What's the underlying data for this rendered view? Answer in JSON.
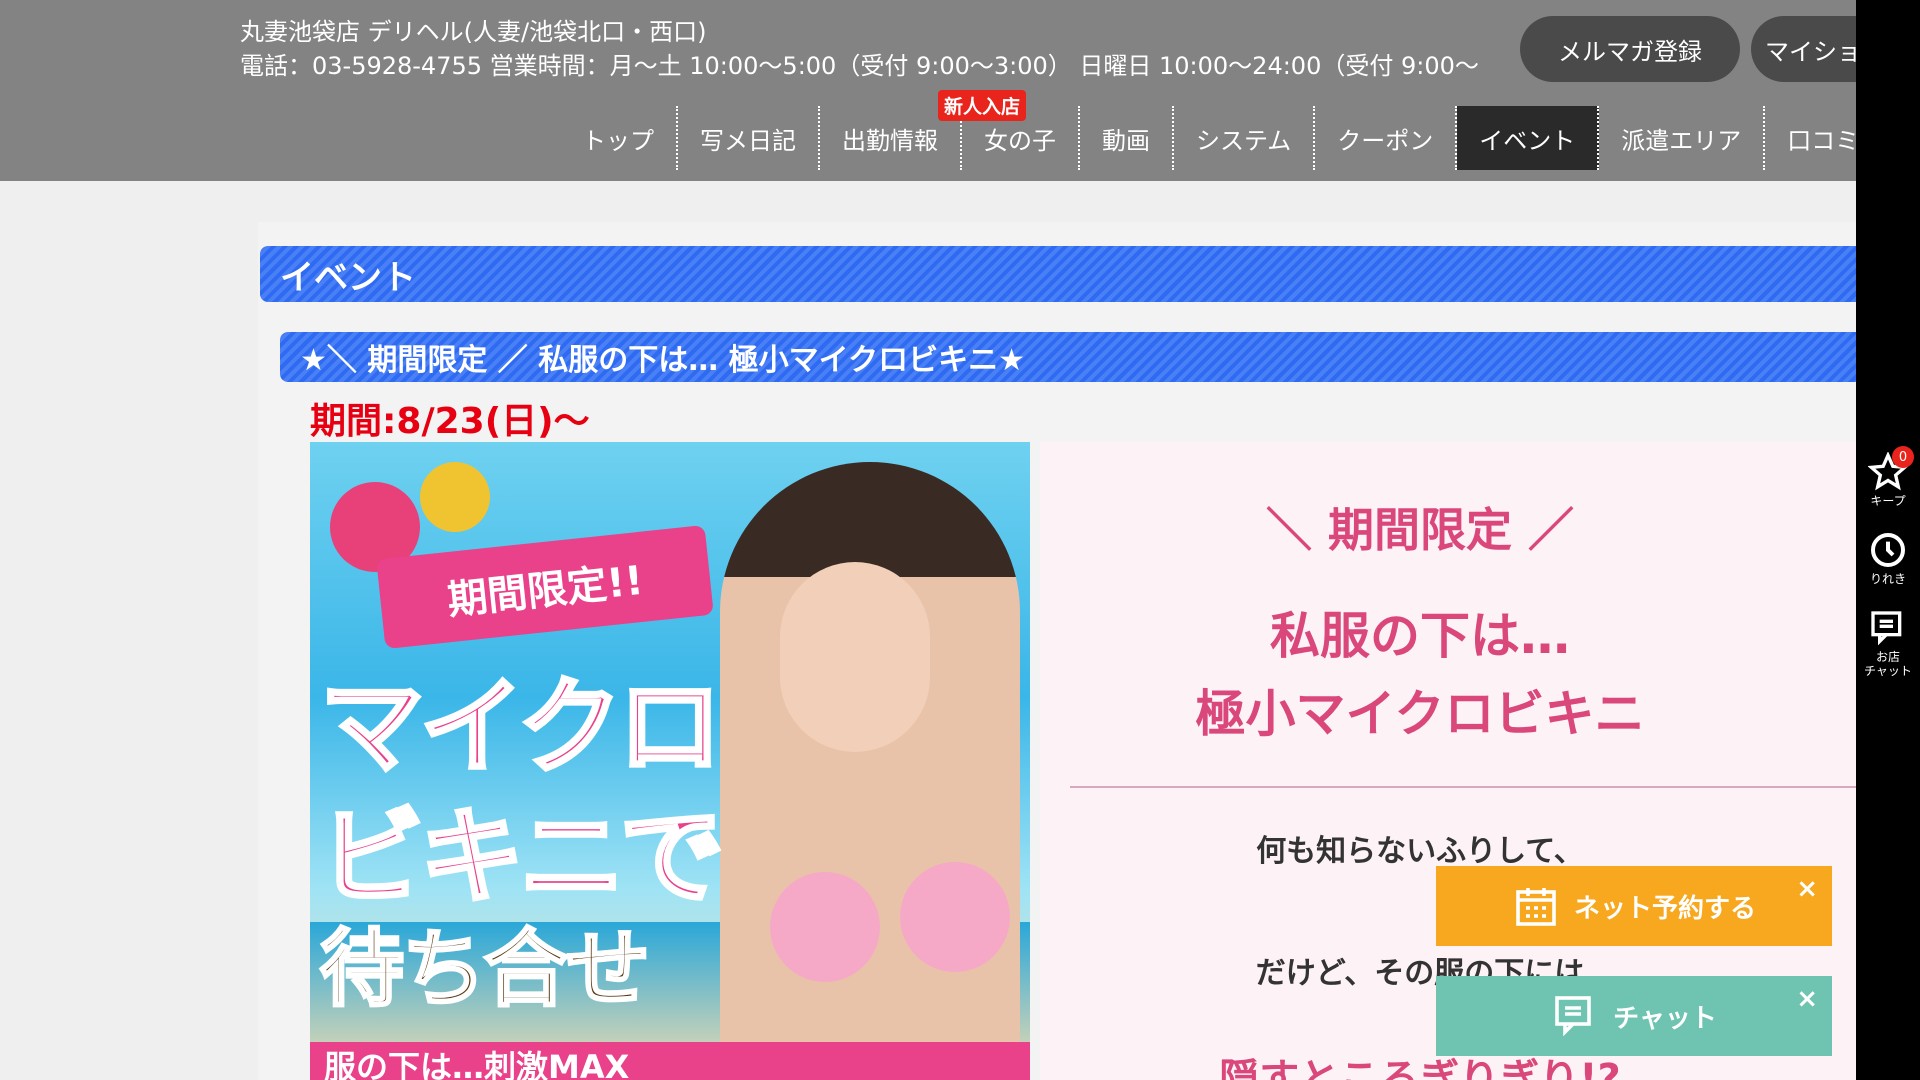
{
  "header": {
    "shop_name": "丸妻池袋店 デリヘル(人妻/池袋北口・西口)",
    "shop_info": "電話：03-5928-4755 営業時間：月〜土 10:00〜5:00（受付 9:00〜3:00） 日曜日 10:00〜24:00（受付 9:00〜",
    "mailmag_label": "メルマガ登録",
    "mypage_label": "マイショ",
    "new_badge": "新人入店"
  },
  "nav": {
    "items": [
      {
        "label": "トップ"
      },
      {
        "label": "写メ日記"
      },
      {
        "label": "出勤情報"
      },
      {
        "label": "女の子"
      },
      {
        "label": "動画"
      },
      {
        "label": "システム"
      },
      {
        "label": "クーポン"
      },
      {
        "label": "イベント"
      },
      {
        "label": "派遣エリア"
      },
      {
        "label": "口コミ"
      }
    ],
    "active": "イベント"
  },
  "sidebar": {
    "keep_label": "キープ",
    "keep_count": "0",
    "history_label": "りれき",
    "chat_label": "お店\nチャット"
  },
  "main": {
    "section_title": "イベント",
    "event_title": "★＼ 期間限定 ／ 私服の下は… 極小マイクロビキニ★",
    "period": "期間:8/23(日)〜",
    "banner": {
      "ribbon": "期間限定!!",
      "line1": "マイクロ",
      "line2": "ビキニで",
      "line3": "待ち合せ",
      "bottom": "服の下は…刺激MAX"
    },
    "info": {
      "line1": "＼ 期間限定 ／",
      "line2": "私服の下は…",
      "line3": "極小マイクロビキニ",
      "p1": "何も知らないふりして、",
      "p2": "だけど、その服の下には",
      "p3": "隠すところぎりぎり!?"
    }
  },
  "cta": {
    "reserve_label": "ネット予約する",
    "chat_label": "チャット",
    "close": "×"
  },
  "colors": {
    "header_bg": "#838383",
    "accent_blue": "#2f6bf2",
    "accent_pink": "#d9477b",
    "reserve_orange": "#f8a81e",
    "chat_green": "#6ec4b0"
  }
}
